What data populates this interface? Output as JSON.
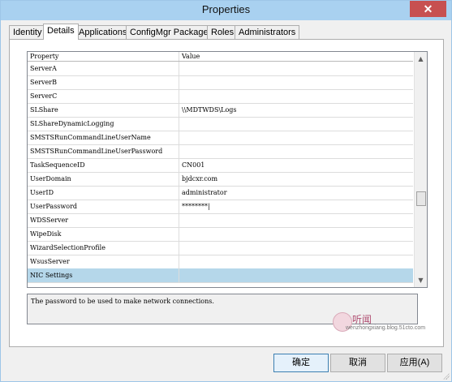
{
  "window": {
    "title": "Properties",
    "close_label": "✕"
  },
  "tabs": [
    {
      "label": "Identity"
    },
    {
      "label": "Details"
    },
    {
      "label": "Applications"
    },
    {
      "label": "ConfigMgr Packages"
    },
    {
      "label": "Roles"
    },
    {
      "label": "Administrators"
    }
  ],
  "grid": {
    "header": {
      "property": "Property",
      "value": "Value"
    },
    "rows": [
      {
        "property": "ServerA",
        "value": ""
      },
      {
        "property": "ServerB",
        "value": ""
      },
      {
        "property": "ServerC",
        "value": ""
      },
      {
        "property": "SLShare",
        "value": "\\\\MDTWDS\\Logs"
      },
      {
        "property": "SLShareDynamicLogging",
        "value": ""
      },
      {
        "property": "SMSTSRunCommandLineUserName",
        "value": ""
      },
      {
        "property": "SMSTSRunCommandLineUserPassword",
        "value": ""
      },
      {
        "property": "TaskSequenceID",
        "value": "CN001"
      },
      {
        "property": "UserDomain",
        "value": "bjdcxr.com"
      },
      {
        "property": "UserID",
        "value": "administrator"
      },
      {
        "property": "UserPassword",
        "value": "********|"
      },
      {
        "property": "WDSServer",
        "value": ""
      },
      {
        "property": "WipeDisk",
        "value": ""
      },
      {
        "property": "WizardSelectionProfile",
        "value": ""
      },
      {
        "property": "WsusServer",
        "value": ""
      },
      {
        "property": "NIC Settings",
        "value": ""
      }
    ]
  },
  "description": "The password to be used to make network connections.",
  "watermark": {
    "text": "听闻",
    "url": "wenzhongxiang.blog.51cto.com"
  },
  "buttons": {
    "ok": "确定",
    "cancel": "取消",
    "apply": "应用(A)"
  },
  "colors": {
    "titlebar": "#a9d1f0",
    "close": "#c75050",
    "selected_row": "#b5d7ea"
  }
}
